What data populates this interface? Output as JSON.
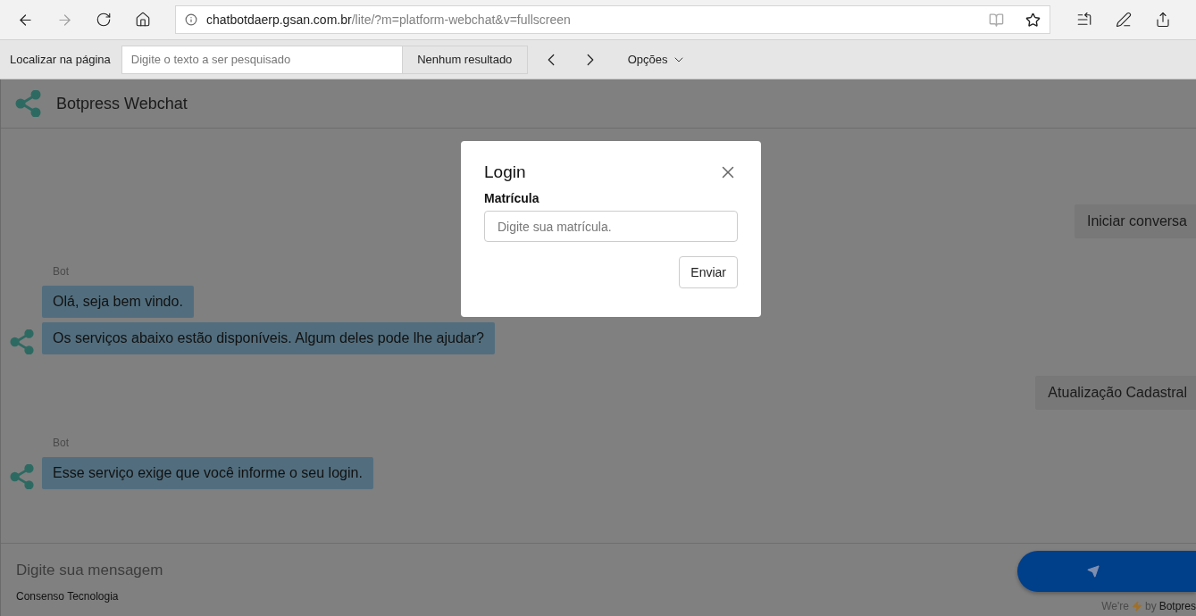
{
  "browser": {
    "address": {
      "domain": "chatbotdaerp.gsan.com.br",
      "path": "/lite/?m=platform-webchat&v=fullscreen"
    },
    "find_bar": {
      "label": "Localizar na página",
      "placeholder": "Digite o texto a ser pesquisado",
      "result": "Nenhum resultado",
      "options": "Opções"
    }
  },
  "chat": {
    "title": "Botpress Webchat",
    "messages": [
      {
        "kind": "user",
        "text": "Iniciar conversa"
      },
      {
        "kind": "bot",
        "sender": "Bot",
        "bubbles": [
          "Olá, seja bem vindo.",
          "Os serviços abaixo estão disponíveis. Algum deles pode lhe ajudar?"
        ]
      },
      {
        "kind": "user",
        "text": "Atualização Cadastral"
      },
      {
        "kind": "bot",
        "sender": "Bot",
        "bubbles": [
          "Esse serviço exige que você informe o seu login."
        ]
      }
    ],
    "composer": {
      "placeholder": "Digite sua mensagem"
    },
    "footer": {
      "brand": "Consenso Tecnologia",
      "powered_prefix": "We're",
      "powered_by": "by",
      "powered_name": "Botpres"
    }
  },
  "modal": {
    "title": "Login",
    "field_label": "Matrícula",
    "placeholder": "Digite sua matrícula.",
    "button": "Enviar"
  }
}
